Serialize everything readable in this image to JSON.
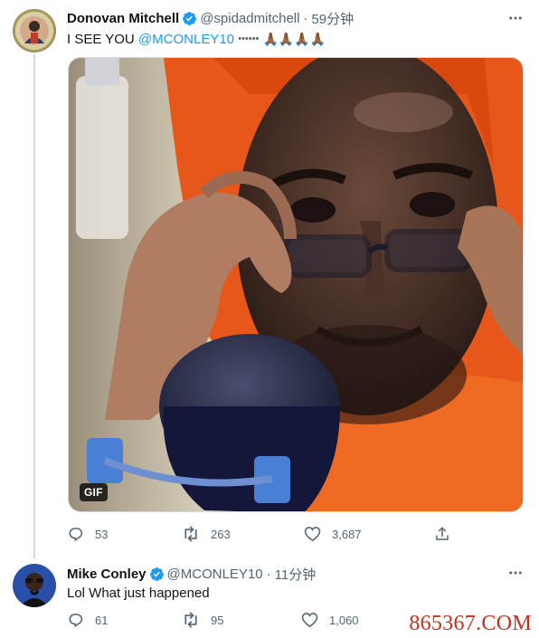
{
  "tweets": [
    {
      "display_name": "Donovan Mitchell",
      "handle": "@spidadmitchell",
      "separator": "·",
      "time": "59分钟",
      "text_prefix": "I SEE YOU ",
      "mention": "@MCONLEY10",
      "dots": "••••••",
      "emojis": "🙏🏾🙏🏾🙏🏾🙏🏾",
      "media_badge": "GIF",
      "replies": "53",
      "retweets": "263",
      "likes": "3,687"
    },
    {
      "display_name": "Mike Conley",
      "handle": "@MCONLEY10",
      "separator": "·",
      "time": "11分钟",
      "text": "Lol What just happened",
      "replies": "61",
      "retweets": "95",
      "likes": "1,060"
    }
  ],
  "watermark": "865367.COM",
  "colors": {
    "verified": "#1d9bf0",
    "mention": "#1d9bf0",
    "secondary_text": "#536471",
    "watermark": "#c0321b"
  },
  "icons": [
    "verified-badge-icon",
    "more-icon",
    "reply-icon",
    "retweet-icon",
    "like-icon",
    "share-icon"
  ]
}
